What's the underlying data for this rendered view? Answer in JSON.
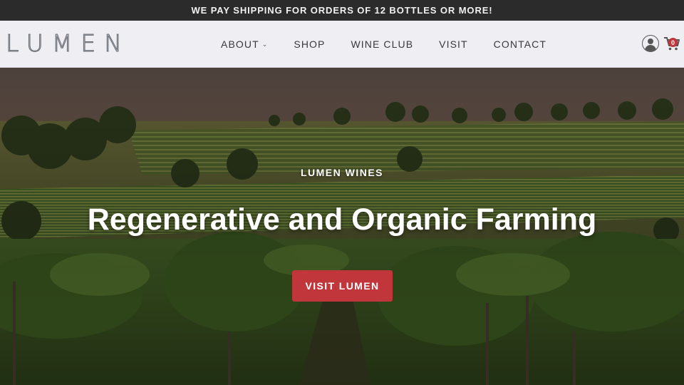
{
  "announcement": {
    "text": "WE PAY SHIPPING FOR ORDERS OF 12 BOTTLES OR MORE!"
  },
  "header": {
    "logo": "LUMEN",
    "nav": [
      {
        "label": "ABOUT",
        "has_dropdown": true
      },
      {
        "label": "SHOP"
      },
      {
        "label": "WINE CLUB"
      },
      {
        "label": "VISIT"
      },
      {
        "label": "CONTACT"
      }
    ],
    "dropdown_glyph": "⌄",
    "icons": {
      "account": "user-icon",
      "cart": "cart-icon"
    },
    "cart_count": "0"
  },
  "hero": {
    "eyebrow": "LUMEN WINES",
    "title": "Regenerative and Organic Farming",
    "cta_label": "VISIT LUMEN"
  },
  "colors": {
    "announcement_bg": "#2b2b2b",
    "header_bg": "#eeeef3",
    "accent": "#c0363b"
  }
}
